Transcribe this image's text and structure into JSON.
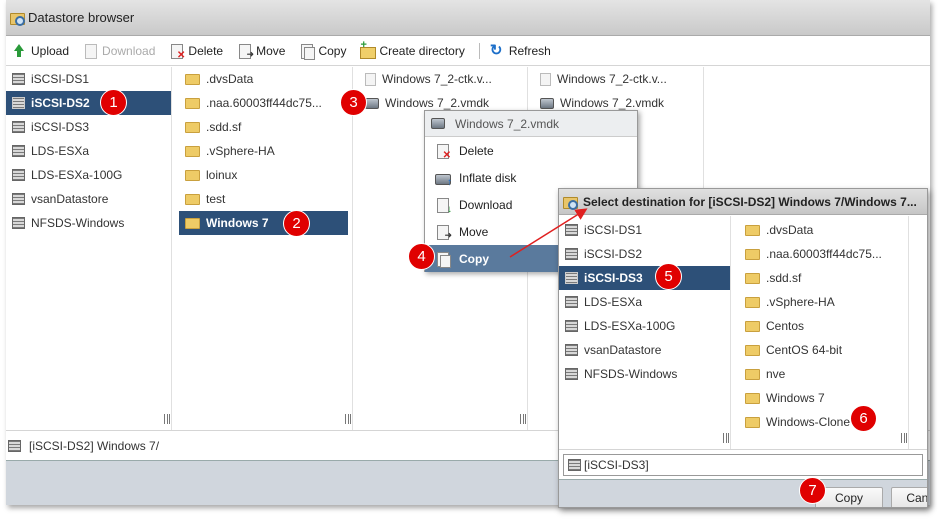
{
  "window": {
    "title": "Datastore browser"
  },
  "toolbar": {
    "upload": "Upload",
    "download": "Download",
    "delete": "Delete",
    "move": "Move",
    "copy": "Copy",
    "create_directory": "Create directory",
    "refresh": "Refresh"
  },
  "datastores": [
    {
      "label": "iSCSI-DS1"
    },
    {
      "label": "iSCSI-DS2",
      "selected": true
    },
    {
      "label": "iSCSI-DS3"
    },
    {
      "label": "LDS-ESXa"
    },
    {
      "label": "LDS-ESXa-100G"
    },
    {
      "label": "vsanDatastore"
    },
    {
      "label": "NFSDS-Windows"
    }
  ],
  "folders": [
    {
      "label": ".dvsData"
    },
    {
      "label": ".naa.60003ff44dc75..."
    },
    {
      "label": ".sdd.sf"
    },
    {
      "label": ".vSphere-HA"
    },
    {
      "label": "loinux"
    },
    {
      "label": "test"
    },
    {
      "label": "Windows 7",
      "selected": true
    }
  ],
  "files": [
    {
      "label": "Windows 7_2-ctk.v...",
      "icon": "file-icon"
    },
    {
      "label": "Windows 7_2.vmdk",
      "icon": "disk-icon"
    }
  ],
  "files_preview": [
    {
      "label": "Windows 7_2-ctk.v...",
      "icon": "file-icon"
    },
    {
      "label": "Windows 7_2.vmdk",
      "icon": "disk-icon"
    }
  ],
  "path": "[iSCSI-DS2] Windows 7/",
  "context_menu": {
    "header": "Windows 7_2.vmdk",
    "items": [
      {
        "label": "Delete"
      },
      {
        "label": "Inflate disk"
      },
      {
        "label": "Download"
      },
      {
        "label": "Move"
      },
      {
        "label": "Copy",
        "selected": true
      }
    ]
  },
  "dialog": {
    "title": "Select destination for [iSCSI-DS2] Windows 7/Windows 7...",
    "datastores": [
      {
        "label": "iSCSI-DS1"
      },
      {
        "label": "iSCSI-DS2"
      },
      {
        "label": "iSCSI-DS3",
        "selected": true
      },
      {
        "label": "LDS-ESXa"
      },
      {
        "label": "LDS-ESXa-100G"
      },
      {
        "label": "vsanDatastore"
      },
      {
        "label": "NFSDS-Windows"
      }
    ],
    "folders": [
      {
        "label": ".dvsData"
      },
      {
        "label": ".naa.60003ff44dc75..."
      },
      {
        "label": ".sdd.sf"
      },
      {
        "label": ".vSphere-HA"
      },
      {
        "label": "Centos"
      },
      {
        "label": "CentOS 64-bit"
      },
      {
        "label": "nve"
      },
      {
        "label": "Windows 7"
      },
      {
        "label": "Windows-Clone"
      }
    ],
    "path": "[iSCSI-DS3]",
    "copy_button": "Copy",
    "cancel_button": "Cancel"
  },
  "annotations": [
    "1",
    "2",
    "3",
    "4",
    "5",
    "6",
    "7"
  ],
  "colors": {
    "selection": "#2d5078",
    "menu_selection": "#5a7a9d",
    "badge": "#e00000",
    "arrow": "#e02020"
  }
}
